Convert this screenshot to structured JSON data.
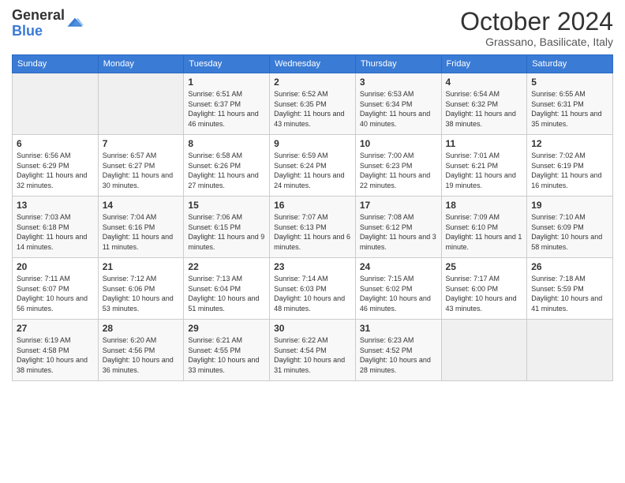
{
  "logo": {
    "general": "General",
    "blue": "Blue"
  },
  "header": {
    "month": "October 2024",
    "subtitle": "Grassano, Basilicate, Italy"
  },
  "weekdays": [
    "Sunday",
    "Monday",
    "Tuesday",
    "Wednesday",
    "Thursday",
    "Friday",
    "Saturday"
  ],
  "weeks": [
    [
      {
        "day": "",
        "info": ""
      },
      {
        "day": "",
        "info": ""
      },
      {
        "day": "1",
        "sunrise": "Sunrise: 6:51 AM",
        "sunset": "Sunset: 6:37 PM",
        "daylight": "Daylight: 11 hours and 46 minutes."
      },
      {
        "day": "2",
        "sunrise": "Sunrise: 6:52 AM",
        "sunset": "Sunset: 6:35 PM",
        "daylight": "Daylight: 11 hours and 43 minutes."
      },
      {
        "day": "3",
        "sunrise": "Sunrise: 6:53 AM",
        "sunset": "Sunset: 6:34 PM",
        "daylight": "Daylight: 11 hours and 40 minutes."
      },
      {
        "day": "4",
        "sunrise": "Sunrise: 6:54 AM",
        "sunset": "Sunset: 6:32 PM",
        "daylight": "Daylight: 11 hours and 38 minutes."
      },
      {
        "day": "5",
        "sunrise": "Sunrise: 6:55 AM",
        "sunset": "Sunset: 6:31 PM",
        "daylight": "Daylight: 11 hours and 35 minutes."
      }
    ],
    [
      {
        "day": "6",
        "sunrise": "Sunrise: 6:56 AM",
        "sunset": "Sunset: 6:29 PM",
        "daylight": "Daylight: 11 hours and 32 minutes."
      },
      {
        "day": "7",
        "sunrise": "Sunrise: 6:57 AM",
        "sunset": "Sunset: 6:27 PM",
        "daylight": "Daylight: 11 hours and 30 minutes."
      },
      {
        "day": "8",
        "sunrise": "Sunrise: 6:58 AM",
        "sunset": "Sunset: 6:26 PM",
        "daylight": "Daylight: 11 hours and 27 minutes."
      },
      {
        "day": "9",
        "sunrise": "Sunrise: 6:59 AM",
        "sunset": "Sunset: 6:24 PM",
        "daylight": "Daylight: 11 hours and 24 minutes."
      },
      {
        "day": "10",
        "sunrise": "Sunrise: 7:00 AM",
        "sunset": "Sunset: 6:23 PM",
        "daylight": "Daylight: 11 hours and 22 minutes."
      },
      {
        "day": "11",
        "sunrise": "Sunrise: 7:01 AM",
        "sunset": "Sunset: 6:21 PM",
        "daylight": "Daylight: 11 hours and 19 minutes."
      },
      {
        "day": "12",
        "sunrise": "Sunrise: 7:02 AM",
        "sunset": "Sunset: 6:19 PM",
        "daylight": "Daylight: 11 hours and 16 minutes."
      }
    ],
    [
      {
        "day": "13",
        "sunrise": "Sunrise: 7:03 AM",
        "sunset": "Sunset: 6:18 PM",
        "daylight": "Daylight: 11 hours and 14 minutes."
      },
      {
        "day": "14",
        "sunrise": "Sunrise: 7:04 AM",
        "sunset": "Sunset: 6:16 PM",
        "daylight": "Daylight: 11 hours and 11 minutes."
      },
      {
        "day": "15",
        "sunrise": "Sunrise: 7:06 AM",
        "sunset": "Sunset: 6:15 PM",
        "daylight": "Daylight: 11 hours and 9 minutes."
      },
      {
        "day": "16",
        "sunrise": "Sunrise: 7:07 AM",
        "sunset": "Sunset: 6:13 PM",
        "daylight": "Daylight: 11 hours and 6 minutes."
      },
      {
        "day": "17",
        "sunrise": "Sunrise: 7:08 AM",
        "sunset": "Sunset: 6:12 PM",
        "daylight": "Daylight: 11 hours and 3 minutes."
      },
      {
        "day": "18",
        "sunrise": "Sunrise: 7:09 AM",
        "sunset": "Sunset: 6:10 PM",
        "daylight": "Daylight: 11 hours and 1 minute."
      },
      {
        "day": "19",
        "sunrise": "Sunrise: 7:10 AM",
        "sunset": "Sunset: 6:09 PM",
        "daylight": "Daylight: 10 hours and 58 minutes."
      }
    ],
    [
      {
        "day": "20",
        "sunrise": "Sunrise: 7:11 AM",
        "sunset": "Sunset: 6:07 PM",
        "daylight": "Daylight: 10 hours and 56 minutes."
      },
      {
        "day": "21",
        "sunrise": "Sunrise: 7:12 AM",
        "sunset": "Sunset: 6:06 PM",
        "daylight": "Daylight: 10 hours and 53 minutes."
      },
      {
        "day": "22",
        "sunrise": "Sunrise: 7:13 AM",
        "sunset": "Sunset: 6:04 PM",
        "daylight": "Daylight: 10 hours and 51 minutes."
      },
      {
        "day": "23",
        "sunrise": "Sunrise: 7:14 AM",
        "sunset": "Sunset: 6:03 PM",
        "daylight": "Daylight: 10 hours and 48 minutes."
      },
      {
        "day": "24",
        "sunrise": "Sunrise: 7:15 AM",
        "sunset": "Sunset: 6:02 PM",
        "daylight": "Daylight: 10 hours and 46 minutes."
      },
      {
        "day": "25",
        "sunrise": "Sunrise: 7:17 AM",
        "sunset": "Sunset: 6:00 PM",
        "daylight": "Daylight: 10 hours and 43 minutes."
      },
      {
        "day": "26",
        "sunrise": "Sunrise: 7:18 AM",
        "sunset": "Sunset: 5:59 PM",
        "daylight": "Daylight: 10 hours and 41 minutes."
      }
    ],
    [
      {
        "day": "27",
        "sunrise": "Sunrise: 6:19 AM",
        "sunset": "Sunset: 4:58 PM",
        "daylight": "Daylight: 10 hours and 38 minutes."
      },
      {
        "day": "28",
        "sunrise": "Sunrise: 6:20 AM",
        "sunset": "Sunset: 4:56 PM",
        "daylight": "Daylight: 10 hours and 36 minutes."
      },
      {
        "day": "29",
        "sunrise": "Sunrise: 6:21 AM",
        "sunset": "Sunset: 4:55 PM",
        "daylight": "Daylight: 10 hours and 33 minutes."
      },
      {
        "day": "30",
        "sunrise": "Sunrise: 6:22 AM",
        "sunset": "Sunset: 4:54 PM",
        "daylight": "Daylight: 10 hours and 31 minutes."
      },
      {
        "day": "31",
        "sunrise": "Sunrise: 6:23 AM",
        "sunset": "Sunset: 4:52 PM",
        "daylight": "Daylight: 10 hours and 28 minutes."
      },
      {
        "day": "",
        "info": ""
      },
      {
        "day": "",
        "info": ""
      }
    ]
  ]
}
